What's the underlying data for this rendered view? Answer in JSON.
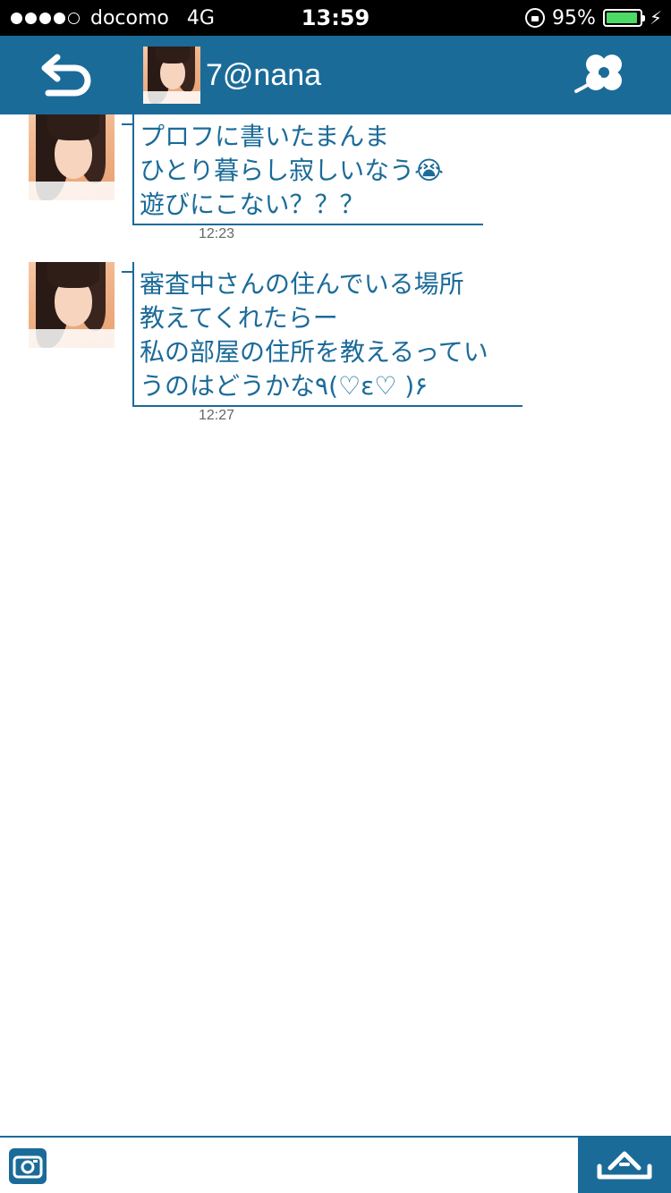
{
  "status_bar": {
    "carrier": "docomo",
    "network": "4G",
    "time": "13:59",
    "battery_percent": "95%",
    "battery_level": 0.95
  },
  "header": {
    "contact_name": "7@nana",
    "back_icon": "back-arrow-icon",
    "menu_icon": "clover-icon"
  },
  "messages": [
    {
      "text": "プロフに書いたまんま\nひとり暮らし寂しいなう😭\n遊びにこない？？？",
      "time": "12:23"
    },
    {
      "text": "審査中さんの住んでいる場所\n教えてくれたらー\n私の部屋の住所を教えるってい\nうのはどうかな٩(♡ε♡ )۶",
      "time": "12:27"
    }
  ],
  "composer": {
    "placeholder": "",
    "camera_icon": "camera-icon",
    "send_icon": "send-icon"
  },
  "colors": {
    "accent": "#1b6b99",
    "status_bar": "#000000",
    "battery": "#4cd964"
  }
}
